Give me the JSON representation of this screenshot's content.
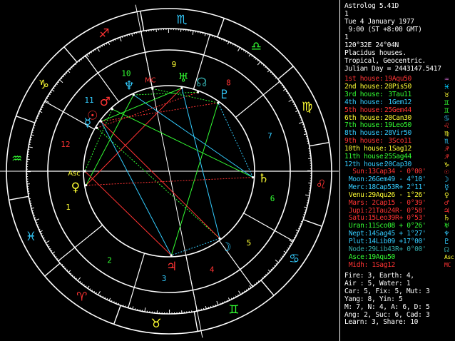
{
  "header": {
    "title": "Astrolog 5.41D",
    "num": "1",
    "date": "Tue 4 January 1977",
    "time": " 9:00 (ST +8:00 GMT)",
    "num2": "1",
    "location": "120°32E 24°04N",
    "houses": "Placidus houses.",
    "zodiac": "Tropical, Geocentric.",
    "julian": "Julian Day = 2443147.5417"
  },
  "houses": [
    {
      "label": "1st house:",
      "pos": "19Aqu50",
      "color": "#ff3333",
      "glyph": "♒",
      "gcolor": "#cc66cc"
    },
    {
      "label": "2nd house:",
      "pos": "28Pis50",
      "color": "#ffff33",
      "glyph": "♓",
      "gcolor": "#00ccff"
    },
    {
      "label": "3rd house:",
      "pos": " 3Tau11",
      "color": "#33ff33",
      "glyph": "♉",
      "gcolor": "#ffff33"
    },
    {
      "label": "4th house:",
      "pos": " 1Gem12",
      "color": "#33ccff",
      "glyph": "♊",
      "gcolor": "#33ff33"
    },
    {
      "label": "5th house:",
      "pos": "25Gem44",
      "color": "#ff3333",
      "glyph": "♊",
      "gcolor": "#33ff33"
    },
    {
      "label": "6th house:",
      "pos": "20Can30",
      "color": "#ffff33",
      "glyph": "♋",
      "gcolor": "#33ccff"
    },
    {
      "label": "7th house:",
      "pos": "19Leo50",
      "color": "#33ff33",
      "glyph": "♌",
      "gcolor": "#ff3333"
    },
    {
      "label": "8th house:",
      "pos": "28Vir50",
      "color": "#33ccff",
      "glyph": "♍",
      "gcolor": "#ffff33"
    },
    {
      "label": "9th house:",
      "pos": " 3Sco11",
      "color": "#ff3333",
      "glyph": "♏",
      "gcolor": "#33ccff"
    },
    {
      "label": "10th house:",
      "pos": " 1Sag12",
      "color": "#ffff33",
      "glyph": "♐",
      "gcolor": "#ff3333"
    },
    {
      "label": "11th house:",
      "pos": "25Sag44",
      "color": "#33ff33",
      "glyph": "♐",
      "gcolor": "#ff3333"
    },
    {
      "label": "12th house:",
      "pos": "20Cap30",
      "color": "#33ccff",
      "glyph": "♑",
      "gcolor": "#ffff33"
    }
  ],
  "planets": [
    {
      "label": "Sun:",
      "pos": "13Cap34",
      "lat": " - 0°00'",
      "color": "#ff3333",
      "glyph": "☉",
      "gcolor": "#ff3333"
    },
    {
      "label": "Moon:",
      "pos": "26Gem49",
      "lat": " - 4°10'",
      "color": "#33ccff",
      "glyph": "☽",
      "gcolor": "#33ccff"
    },
    {
      "label": "Merc:",
      "pos": "18Cap53R",
      "lat": "+ 2°11'",
      "color": "#33ccff",
      "glyph": "☿",
      "gcolor": "#33ccff"
    },
    {
      "label": "Venu:",
      "pos": "29Aqu26",
      "lat": " - 1°26'",
      "color": "#ffff33",
      "glyph": "♀",
      "gcolor": "#ffff33"
    },
    {
      "label": "Mars:",
      "pos": " 2Cap15",
      "lat": " - 0°39'",
      "color": "#ff3333",
      "glyph": "♂",
      "gcolor": "#ff3333"
    },
    {
      "label": "Jupi:",
      "pos": "21Tau24R",
      "lat": "- 0°58'",
      "color": "#ff3333",
      "glyph": "♃",
      "gcolor": "#ff3333"
    },
    {
      "label": "Satu:",
      "pos": "15Leo39R",
      "lat": "+ 0°53'",
      "color": "#ff3333",
      "glyph": "♄",
      "gcolor": "#ffff33"
    },
    {
      "label": "Uran:",
      "pos": "11Sco08",
      "lat": " + 0°26'",
      "color": "#33ff33",
      "glyph": "♅",
      "gcolor": "#33ff33"
    },
    {
      "label": "Nept:",
      "pos": "14Sag45",
      "lat": " + 1°27'",
      "color": "#33ccff",
      "glyph": "♆",
      "gcolor": "#33ccff"
    },
    {
      "label": "Plut:",
      "pos": "14Lib09",
      "lat": " +17°00'",
      "color": "#33ccff",
      "glyph": "♇",
      "gcolor": "#33ccff"
    },
    {
      "label": "Node:",
      "pos": "29Lib43R",
      "lat": "+ 0°00'",
      "color": "#33aaaa",
      "glyph": "☊",
      "gcolor": "#33aaaa"
    },
    {
      "label": "Asce:",
      "pos": "19Aqu50",
      "lat": "",
      "color": "#33ff33",
      "glyph": "Asc",
      "gcolor": "#ffff33"
    },
    {
      "label": "Midh:",
      "pos": " 1Sag12",
      "lat": "",
      "color": "#ff3333",
      "glyph": "MC",
      "gcolor": "#ff3333"
    }
  ],
  "summary": [
    "Fire: 3, Earth: 4,",
    "Air : 5, Water: 1",
    "Car: 5, Fix: 5, Mut: 3",
    "Yang: 8, Yin: 5",
    "M: 7, N: 4, A: 6, D: 5",
    "Ang: 2, Suc: 6, Cad: 3",
    "Learn: 3, Share: 10"
  ],
  "wheel": {
    "asc_label": "Asc",
    "mc_label": "MC",
    "house_numbers": [
      "1",
      "2",
      "3",
      "4",
      "5",
      "6",
      "7",
      "8",
      "9",
      "10",
      "11",
      "12"
    ]
  }
}
